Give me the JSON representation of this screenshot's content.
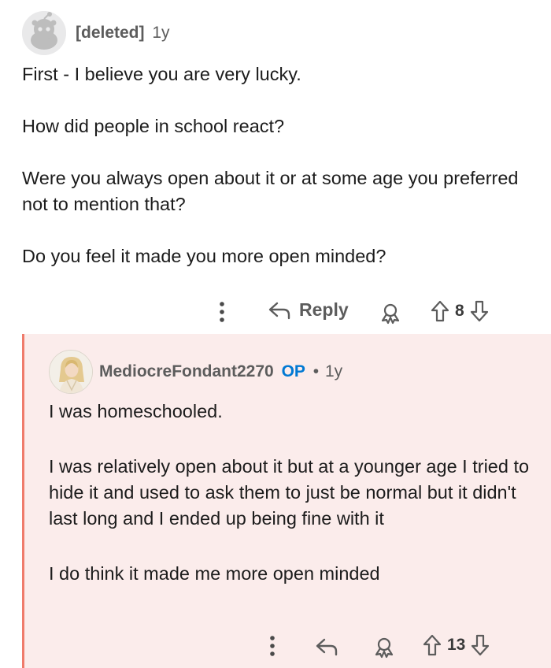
{
  "comment": {
    "author": "[deleted]",
    "age": "1y",
    "paragraphs": [
      "First - I believe you are very lucky.",
      "How did people in school react?",
      "Were you always open about it or at some age you preferred not to mention that?",
      "Do you feel it made you more open minded?"
    ],
    "actions": {
      "more_icon": "more-vertical-icon",
      "reply_label": "Reply",
      "vote_count": "8"
    }
  },
  "reply": {
    "author": "MediocreFondant2270",
    "op_badge": "OP",
    "separator": "•",
    "age": "1y",
    "paragraphs": [
      "I was homeschooled.",
      "I was relatively open about it but at a younger age I tried to hide it and used to ask them to just be normal but it didn't last long and I ended up being fine with it",
      "I do think it made me more open minded"
    ],
    "actions": {
      "vote_count": "13"
    }
  },
  "colors": {
    "reply_background": "#fbeceb",
    "thread_line": "#ef7b6b",
    "op_blue": "#0079d3",
    "meta_gray": "#5c5c5c"
  }
}
